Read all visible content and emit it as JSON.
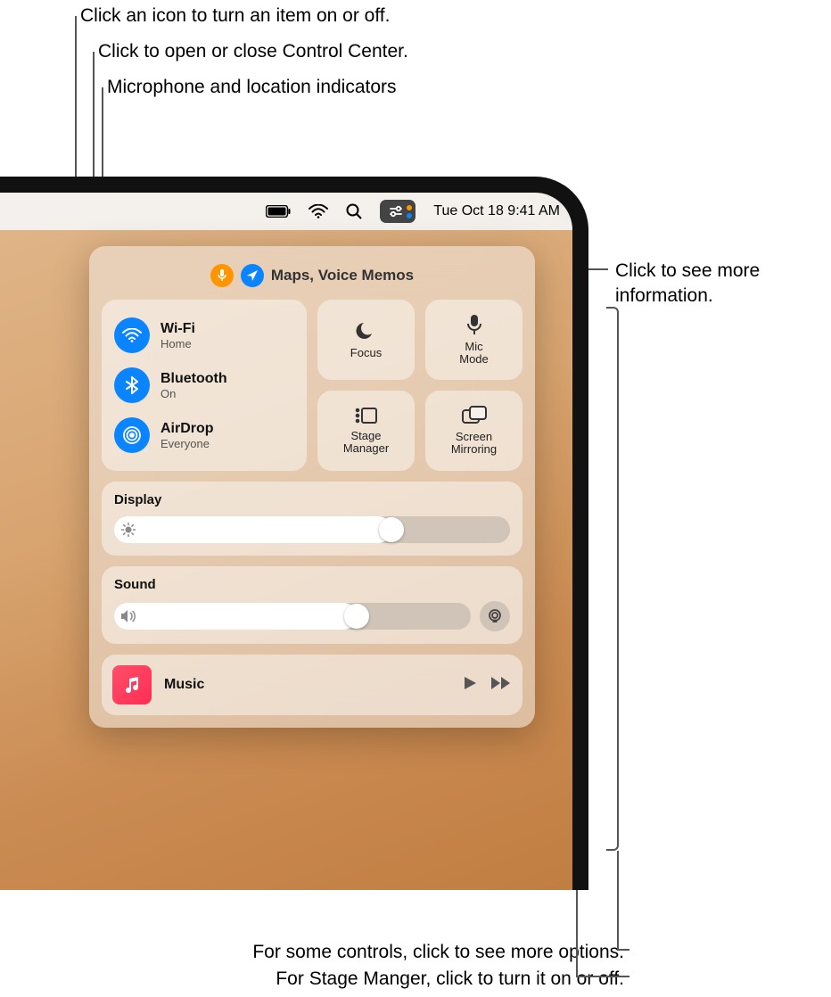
{
  "callouts": {
    "toggle_icon": "Click an icon to turn an item on or off.",
    "open_close": "Click to open or close Control Center.",
    "indicators": "Microphone and location indicators",
    "more_info_l1": "Click to see more",
    "more_info_l2": "information.",
    "bottom1": "For some controls, click to see more options.",
    "bottom2": "For Stage Manger, click to turn it on or off."
  },
  "menubar": {
    "datetime": "Tue Oct 18  9:41 AM"
  },
  "privacy": {
    "apps": "Maps, Voice Memos"
  },
  "connectivity": {
    "wifi": {
      "title": "Wi-Fi",
      "sub": "Home"
    },
    "bluetooth": {
      "title": "Bluetooth",
      "sub": "On"
    },
    "airdrop": {
      "title": "AirDrop",
      "sub": "Everyone"
    }
  },
  "modules": {
    "focus": "Focus",
    "micmode_l1": "Mic",
    "micmode_l2": "Mode",
    "stage_l1": "Stage",
    "stage_l2": "Manager",
    "mirror_l1": "Screen",
    "mirror_l2": "Mirroring"
  },
  "sliders": {
    "display": {
      "title": "Display",
      "percent": 70
    },
    "sound": {
      "title": "Sound",
      "percent": 68
    }
  },
  "music": {
    "title": "Music"
  }
}
